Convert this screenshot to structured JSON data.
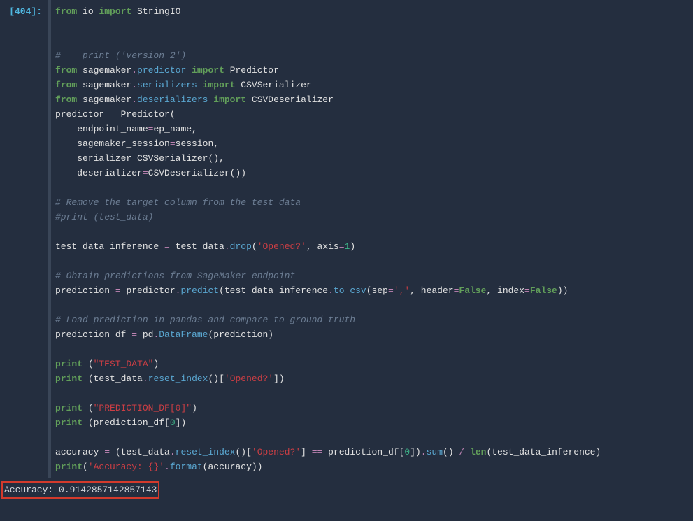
{
  "cell": {
    "prompt": "[404]:",
    "line1_from": "from",
    "line1_mod": " io ",
    "line1_import": "import",
    "line1_name": " StringIO",
    "line3_cmt": "#    print ('version 2')",
    "line4_from": "from",
    "line4_pkg": " sagemaker",
    "line4_dot": ".",
    "line4_sub": "predictor",
    "line4_sp": " ",
    "line4_import": "import",
    "line4_name": " Predictor",
    "line5_from": "from",
    "line5_pkg": " sagemaker",
    "line5_dot": ".",
    "line5_sub": "serializers",
    "line5_sp": " ",
    "line5_import": "import",
    "line5_name": " CSVSerializer",
    "line6_from": "from",
    "line6_pkg": " sagemaker",
    "line6_dot": ".",
    "line6_sub": "deserializers",
    "line6_sp": " ",
    "line6_import": "import",
    "line6_name": " CSVDeserializer",
    "line7_a": "predictor ",
    "line7_eq": "=",
    "line7_b": " Predictor(",
    "line8_a": "    endpoint_name",
    "line8_eq": "=",
    "line8_b": "ep_name,",
    "line9_a": "    sagemaker_session",
    "line9_eq": "=",
    "line9_b": "session,",
    "line10_a": "    serializer",
    "line10_eq": "=",
    "line10_b": "CSVSerializer(),",
    "line11_a": "    deserializer",
    "line11_eq": "=",
    "line11_b": "CSVDeserializer())",
    "line13_cmt": "# Remove the target column from the test data",
    "line14_cmt": "#print (test_data)",
    "line16_a": "test_data_inference ",
    "line16_eq": "=",
    "line16_b": " test_data",
    "line16_dot": ".",
    "line16_fn": "drop",
    "line16_p1": "(",
    "line16_s1": "'Opened?'",
    "line16_c": ", axis",
    "line16_eq2": "=",
    "line16_n": "1",
    "line16_p2": ")",
    "line18_cmt": "# Obtain predictions from SageMaker endpoint",
    "line19_a": "prediction ",
    "line19_eq": "=",
    "line19_b": " predictor",
    "line19_dot": ".",
    "line19_fn": "predict",
    "line19_p1": "(test_data_inference",
    "line19_dot2": ".",
    "line19_fn2": "to_csv",
    "line19_p2": "(sep",
    "line19_eq2": "=",
    "line19_s1": "','",
    "line19_c2": ", header",
    "line19_eq3": "=",
    "line19_kc1": "False",
    "line19_c3": ", index",
    "line19_eq4": "=",
    "line19_kc2": "False",
    "line19_p3": "))",
    "line21_cmt": "# Load prediction in pandas and compare to ground truth",
    "line22_a": "prediction_df ",
    "line22_eq": "=",
    "line22_b": " pd",
    "line22_dot": ".",
    "line22_fn": "DataFrame",
    "line22_p": "(prediction)",
    "line24_print": "print",
    "line24_sp": " (",
    "line24_s": "\"TEST_DATA\"",
    "line24_p": ")",
    "line25_print": "print",
    "line25_sp": " (test_data",
    "line25_dot": ".",
    "line25_fn": "reset_index",
    "line25_mid": "()[",
    "line25_s": "'Opened?'",
    "line25_p": "])",
    "line27_print": "print",
    "line27_sp": " (",
    "line27_s": "\"PREDICTION_DF[0]\"",
    "line27_p": ")",
    "line28_print": "print",
    "line28_sp": " (prediction_df[",
    "line28_n": "0",
    "line28_p": "])",
    "line30_a": "accuracy ",
    "line30_eq": "=",
    "line30_b": " (test_data",
    "line30_dot": ".",
    "line30_fn": "reset_index",
    "line30_mid": "()[",
    "line30_s": "'Opened?'",
    "line30_mid2": "] ",
    "line30_eqeq": "==",
    "line30_b2": " prediction_df[",
    "line30_n0": "0",
    "line30_b3": "])",
    "line30_dot2": ".",
    "line30_fn2": "sum",
    "line30_p2": "() ",
    "line30_div": "/",
    "line30_sp": " ",
    "line30_len": "len",
    "line30_p3": "(test_data_inference)",
    "line31_print": "print",
    "line31_p1": "(",
    "line31_s": "'Accuracy: {}'",
    "line31_dot": ".",
    "line31_fn": "format",
    "line31_p2": "(accuracy))"
  },
  "output": {
    "accuracy": "Accuracy: 0.9142857142857143"
  }
}
